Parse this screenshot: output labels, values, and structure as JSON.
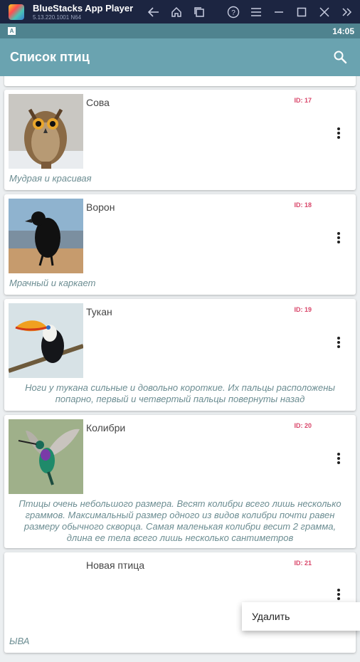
{
  "emulator": {
    "title": "BlueStacks App Player",
    "version": "5.13.220.1001 N64"
  },
  "status_bar": {
    "indicator": "A",
    "time": "14:05"
  },
  "app_bar": {
    "title": "Список птиц"
  },
  "birds": [
    {
      "name": "Сова",
      "id_label": "ID: 17",
      "description": "Мудрая и красивая"
    },
    {
      "name": "Ворон",
      "id_label": "ID: 18",
      "description": "Мрачный и каркает"
    },
    {
      "name": "Тукан",
      "id_label": "ID: 19",
      "description": "Ноги у тукана сильные и довольно короткие. Их пальцы расположены попарно, первый и четвертый пальцы повернуты назад"
    },
    {
      "name": "Колибри",
      "id_label": "ID: 20",
      "description": "Птицы очень небольшого размера. Весят колибри всего лишь несколько граммов. Максимальный размер одного из видов колибри почти равен размеру обычного скворца. Самая маленькая колибри весит 2 грамма, длина ее тела всего лишь несколько сантиметров"
    },
    {
      "name": "Новая птица",
      "id_label": "ID: 21",
      "description": "ЫВА"
    }
  ],
  "context_menu": {
    "delete_label": "Удалить"
  },
  "colors": {
    "status_bar": "#4f838f",
    "app_bar": "#6aa3b0",
    "id_text": "#d9466a",
    "description_text": "#6c8d92"
  }
}
